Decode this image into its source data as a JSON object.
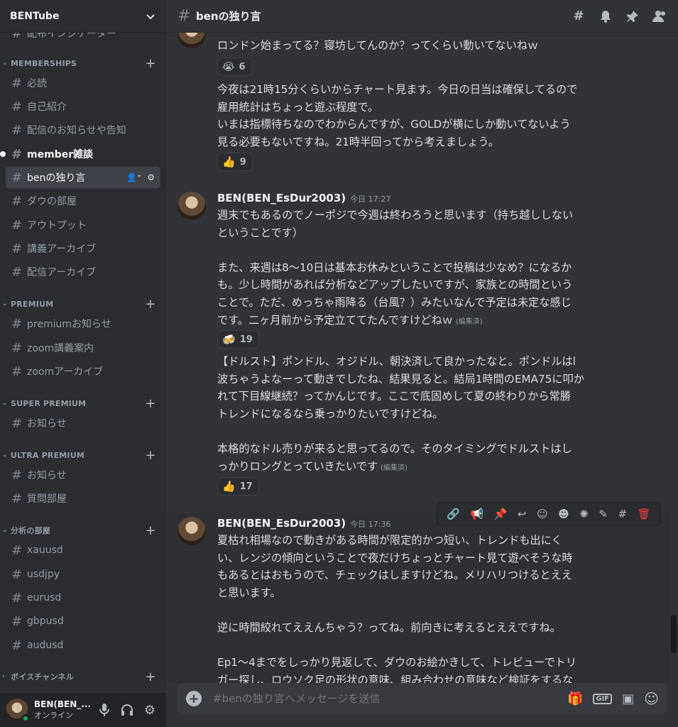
{
  "server": {
    "name": "BENTube"
  },
  "sidebar": {
    "cut_item": "配布インジケーター",
    "categories": [
      {
        "label": "MEMBERSHIPS",
        "channels": [
          "必読",
          "自己紹介",
          "配信のお知らせや告知",
          "member雑談",
          "benの独り言",
          "ダウの部屋",
          "アウトプット",
          "講義アーカイブ",
          "配信アーカイブ"
        ]
      },
      {
        "label": "PREMIUM",
        "channels": [
          "premiumお知らせ",
          "zoom講義案内",
          "zoomアーカイブ"
        ]
      },
      {
        "label": "SUPER PREMIUM",
        "channels": [
          "お知らせ"
        ]
      },
      {
        "label": "ULTRA PREMIUM",
        "channels": [
          "お知らせ",
          "質問部屋"
        ]
      },
      {
        "label": "分析の部屋",
        "channels": [
          "xauusd",
          "usdjpy",
          "eurusd",
          "gbpusd",
          "audusd"
        ]
      },
      {
        "label": "ボイスチャンネル",
        "channels": []
      }
    ]
  },
  "user": {
    "name": "BEN(BEN_...",
    "status": "オンライン"
  },
  "channel": {
    "title": "benの独り言"
  },
  "messages": [
    {
      "author": "",
      "time": "",
      "lines": [
        "ロンドン始まってる？寝坊してんのか？ってくらい動いてないねｗ"
      ],
      "reaction": {
        "emoji": "😭",
        "count": "6"
      }
    },
    {
      "author": "",
      "time": "",
      "lines": [
        "今夜は21時15分くらいからチャート見ます。今日の日当は確保してるので",
        "雇用統計はちょっと遊ぶ程度で。",
        "いまは指標待ちなのでわからんですが、GOLDが横にしか動いてないよう",
        "見る必要もないですね。21時半回ってから考えましょう。"
      ],
      "reaction": {
        "emoji": "👍",
        "count": "9"
      }
    },
    {
      "author": "BEN(BEN_EsDur2003)",
      "time": "今日 17:27",
      "lines": [
        "週末でもあるのでノーポジで今週は終わろうと思います（持ち越ししない",
        "ということです）",
        "",
        "また、来週は8〜10日は基本お休みということで投稿は少なめ？になるか",
        "も。少し時間があれば分析などアップしたいですが、家族との時間という",
        "ことで。ただ、めっちゃ雨降る（台風？）みたいなんで予定は未定な感じ",
        "です。二ヶ月前から予定立ててたんですけどねｗ"
      ],
      "edited": "(編集済)",
      "reaction": {
        "emoji": "🍻",
        "count": "19"
      }
    },
    {
      "author": "",
      "time": "",
      "lines": [
        "【ドルスト】ポンドル、オジドル、朝決済して良かったなと。ポンドルはl",
        "波ちゃうよなーって動きでしたね、結果見ると。結局1時間のEMA75に叩か",
        "れて下目線継続？ってかんじです。ここで底固めして夏の終わりから常勝",
        "トレンドになるなら乗っかりたいですけどね。",
        "",
        "本格的なドル売りが来ると思ってるので。そのタイミングでドルストはし",
        "っかりロングとっていきたいです"
      ],
      "edited": "(編集済)",
      "reaction": {
        "emoji": "👍",
        "count": "17"
      }
    },
    {
      "author": "BEN(BEN_EsDur2003)",
      "time": "今日 17:36",
      "lines": [
        "夏枯れ相場なので動きがある時間が限定的かつ短い、トレンドも出にく",
        "い、レンジの傾向ということで夜だけちょっとチャート見て遊べそうな時",
        "もあるとはおもうので、チェックはしますけどね。メリハリつけるとええ",
        "と思います。",
        "",
        "逆に時間絞れてええんちゃう？ってね。前向きに考えるとええですね。",
        "",
        "Ep1〜4までをしっかり見返して、ダウのお絵かきして、トレビューでトリ",
        "ガー探し、ロウソク足の形状の意味、組み合わせの意味など検証をするな"
      ]
    }
  ],
  "composer": {
    "placeholder": "#benの独り言へメッセージを送信"
  }
}
